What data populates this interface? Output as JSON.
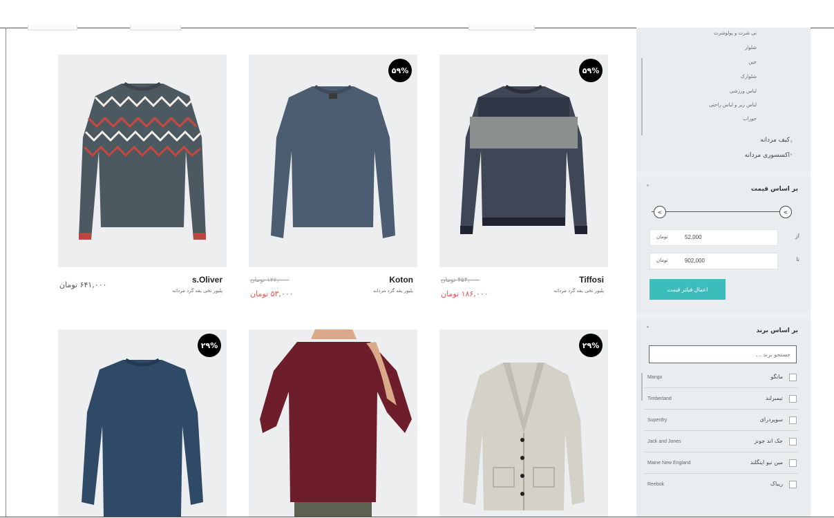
{
  "products": [
    {
      "brand": "s.Oliver",
      "desc": "پلیور نخی یقه گرد مردانه",
      "old_price": "",
      "price": "۶۴۱,۰۰۰ تومان",
      "discount": "",
      "kind": "zigzag"
    },
    {
      "brand": "Koton",
      "desc": "پلیور یقه گرد مردانه",
      "old_price": "۱۲۶,۰۰۰ تومان",
      "price": "۵۳,۰۰۰ تومان",
      "discount": "۵۹%",
      "kind": "plain-blue"
    },
    {
      "brand": "Tiffosi",
      "desc": "پلیور نخی یقه گرد مردانه",
      "old_price": "۴۵۴,۰۰۰ تومان",
      "price": "۱۸۶,۰۰۰ تومان",
      "discount": "۵۹%",
      "kind": "stripe"
    },
    {
      "brand": "",
      "desc": "",
      "old_price": "",
      "price": "",
      "discount": "۲۹%",
      "kind": "navy"
    },
    {
      "brand": "",
      "desc": "",
      "old_price": "",
      "price": "",
      "discount": "",
      "kind": "maroon"
    },
    {
      "brand": "",
      "desc": "",
      "old_price": "",
      "price": "",
      "discount": "۲۹%",
      "kind": "cardigan"
    }
  ],
  "sidebar": {
    "categories": [
      "تی شرت و پولوشرت",
      "شلوار",
      "جین",
      "شلوارک",
      "لباس ورزشی",
      "لباس زیر و لباس راحتی",
      "جوراب"
    ],
    "sections": [
      "کیف مردانه",
      "اکسسوری مردانه"
    ],
    "price_filter": {
      "title": "بر اساس قیمت",
      "from_label": "از",
      "to_label": "تا",
      "from_value": "52,000",
      "to_value": "902,000",
      "unit": "تومان",
      "button": "اعمال فیلتر قیمت"
    },
    "brand_filter": {
      "title": "بر اساس برند",
      "placeholder": "جستجو برند ...",
      "brands": [
        {
          "fa": "مانگو",
          "en": "Mango"
        },
        {
          "fa": "تیمبرلند",
          "en": "Timberland"
        },
        {
          "fa": "سوپردرای",
          "en": "Superdry"
        },
        {
          "fa": "جک اند جونز",
          "en": "Jack and Jones"
        },
        {
          "fa": "مین نیو اینگلند",
          "en": "Maine New England"
        },
        {
          "fa": "ریباک",
          "en": "Reebok"
        }
      ]
    }
  },
  "colors": {
    "accent": "#3dbcbc",
    "sale_price": "#e05a4e",
    "badge": "#000000"
  }
}
